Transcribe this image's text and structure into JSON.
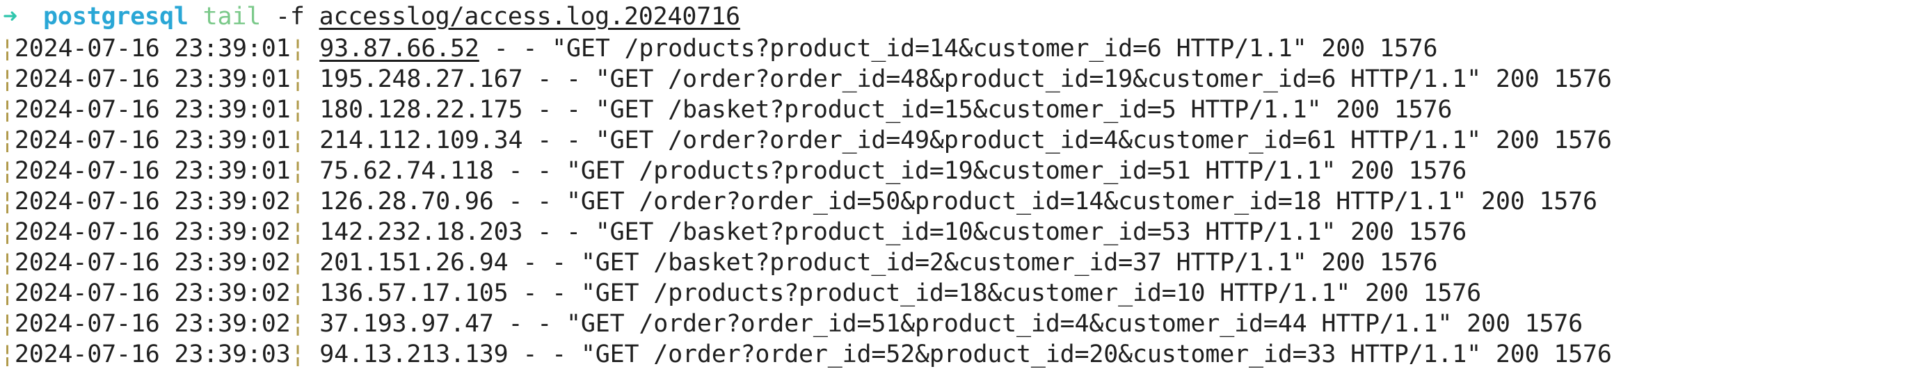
{
  "prompt": {
    "arrow": "➜",
    "directory": "postgresql",
    "command": "tail",
    "flag": "-f",
    "path": "accesslog/access.log.20240716"
  },
  "log_lines": [
    {
      "timestamp": "2024-07-16 23:39:01",
      "ip": "93.87.66.52",
      "request": " - - \"GET /products?product_id=14&customer_id=6 HTTP/1.1\" 200 1576"
    },
    {
      "timestamp": "2024-07-16 23:39:01",
      "ip": "195.248.27.167",
      "request": " - - \"GET /order?order_id=48&product_id=19&customer_id=6 HTTP/1.1\" 200 1576"
    },
    {
      "timestamp": "2024-07-16 23:39:01",
      "ip": "180.128.22.175",
      "request": " - - \"GET /basket?product_id=15&customer_id=5 HTTP/1.1\" 200 1576"
    },
    {
      "timestamp": "2024-07-16 23:39:01",
      "ip": "214.112.109.34",
      "request": " - - \"GET /order?order_id=49&product_id=4&customer_id=61 HTTP/1.1\" 200 1576"
    },
    {
      "timestamp": "2024-07-16 23:39:01",
      "ip": "75.62.74.118",
      "request": " - - \"GET /products?product_id=19&customer_id=51 HTTP/1.1\" 200 1576"
    },
    {
      "timestamp": "2024-07-16 23:39:02",
      "ip": "126.28.70.96",
      "request": " - - \"GET /order?order_id=50&product_id=14&customer_id=18 HTTP/1.1\" 200 1576"
    },
    {
      "timestamp": "2024-07-16 23:39:02",
      "ip": "142.232.18.203",
      "request": " - - \"GET /basket?product_id=10&customer_id=53 HTTP/1.1\" 200 1576"
    },
    {
      "timestamp": "2024-07-16 23:39:02",
      "ip": "201.151.26.94",
      "request": " - - \"GET /basket?product_id=2&customer_id=37 HTTP/1.1\" 200 1576"
    },
    {
      "timestamp": "2024-07-16 23:39:02",
      "ip": "136.57.17.105",
      "request": " - - \"GET /products?product_id=18&customer_id=10 HTTP/1.1\" 200 1576"
    },
    {
      "timestamp": "2024-07-16 23:39:02",
      "ip": "37.193.97.47",
      "request": " - - \"GET /order?order_id=51&product_id=4&customer_id=44 HTTP/1.1\" 200 1576"
    },
    {
      "timestamp": "2024-07-16 23:39:03",
      "ip": "94.13.213.139",
      "request": " - - \"GET /order?order_id=52&product_id=20&customer_id=33 HTTP/1.1\" 200 1576"
    }
  ],
  "colors": {
    "arrow": "#30c6ad",
    "directory": "#2aa7d6",
    "command": "#7bc98a",
    "separator": "#b09a4a",
    "text": "#1f1f1f",
    "background": "#ffffff"
  }
}
